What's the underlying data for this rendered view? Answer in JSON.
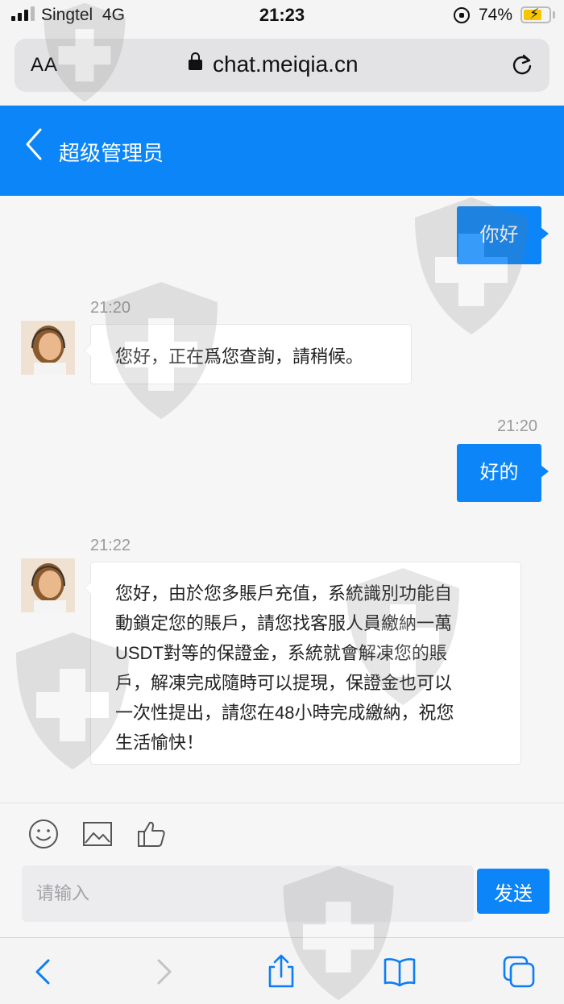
{
  "status_bar": {
    "carrier": "Singtel",
    "network": "4G",
    "time": "21:23",
    "battery_percent": "74%",
    "battery_level": 0.74
  },
  "browser": {
    "text_size_label": "AA",
    "url": "chat.meiqia.cn"
  },
  "chat": {
    "title": "超级管理员",
    "messages": [
      {
        "from": "user",
        "text": "你好"
      },
      {
        "from": "agent",
        "time": "21:20",
        "text": "您好，正在爲您查詢，請稍候。"
      },
      {
        "from": "user",
        "time": "21:20",
        "text": "好的"
      },
      {
        "from": "agent",
        "time": "21:22",
        "lines": [
          "您好，由於您多賬戶充值，系統識別功能自",
          "動鎖定您的賬戶，請您找客服人員繳納一萬",
          "USDT對等的保證金，系統就會解凍您的賬",
          "戶，解凍完成隨時可以提現，保證金也可以",
          "一次性提出，請您在48小時完成繳納，祝您",
          "生活愉快！"
        ]
      }
    ]
  },
  "composer": {
    "placeholder": "请输入",
    "send_label": "发送",
    "tools": [
      "emoji-icon",
      "image-icon",
      "thumbs-up-icon"
    ]
  },
  "toolbar": {
    "icons": [
      "back-icon",
      "forward-icon",
      "share-icon",
      "bookmarks-icon",
      "tabs-icon"
    ]
  },
  "colors": {
    "accent": "#0b85f8",
    "background": "#f6f6f7"
  }
}
